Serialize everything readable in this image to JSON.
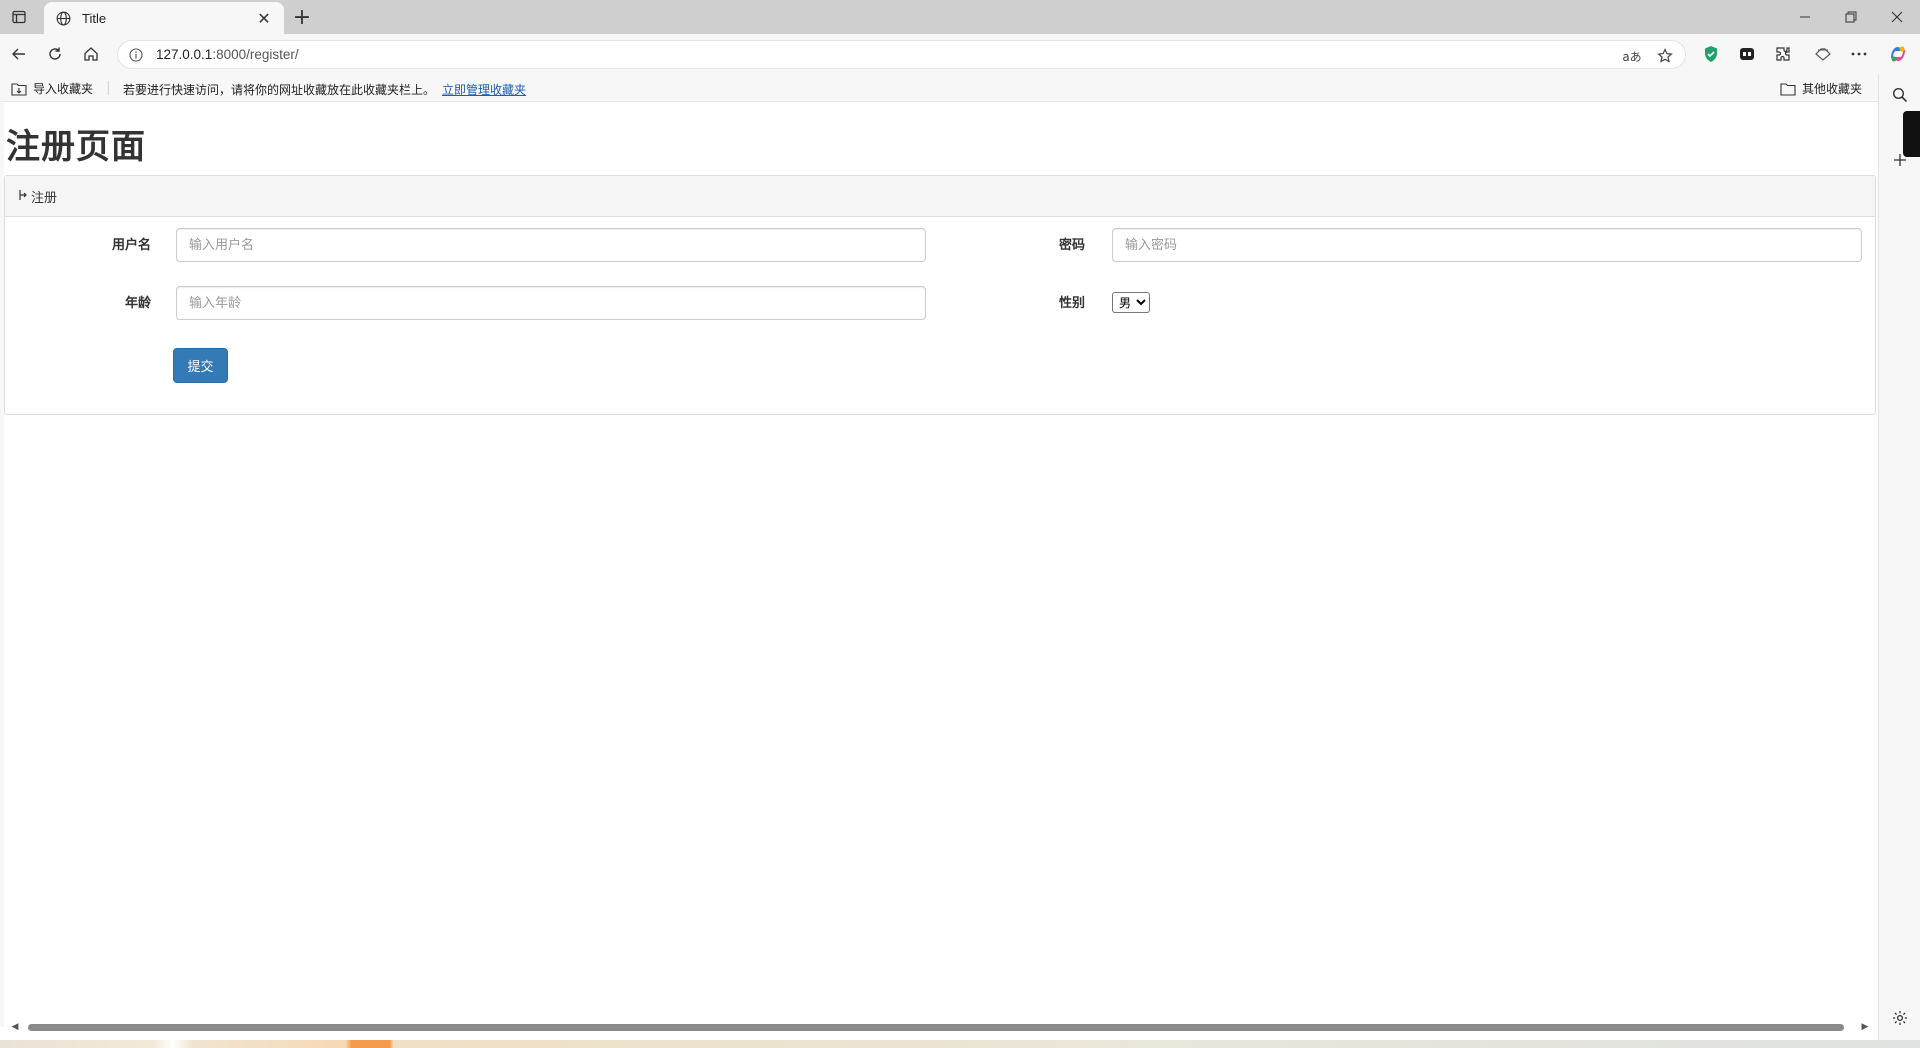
{
  "browser": {
    "tab": {
      "title": "Title"
    },
    "window_controls": [
      "minimize",
      "restore",
      "close"
    ],
    "address": {
      "host": "127.0.0.1",
      "path": ":8000/register/",
      "read_aloud_label": "aあ"
    },
    "bookmarks": {
      "import_label": "导入收藏夹",
      "hint": "若要进行快速访问，请将你的网址收藏放在此收藏夹栏上。",
      "manage_link": "立即管理收藏夹",
      "other_label": "其他收藏夹"
    },
    "colors": {
      "chrome": "#f7f7f7",
      "tabstrip": "#cfcfcf",
      "link": "#1a5fb4"
    }
  },
  "page": {
    "title": "注册页面",
    "panel_heading": "注册",
    "form": {
      "username_label": "用户名",
      "username_placeholder": "输入用户名",
      "password_label": "密码",
      "password_placeholder": "输入密码",
      "age_label": "年龄",
      "age_placeholder": "输入年龄",
      "gender_label": "性别",
      "gender_selected": "男",
      "submit_label": "提交"
    },
    "colors": {
      "primary_button": "#337ab7",
      "panel_heading_bg": "#f5f5f5"
    }
  }
}
